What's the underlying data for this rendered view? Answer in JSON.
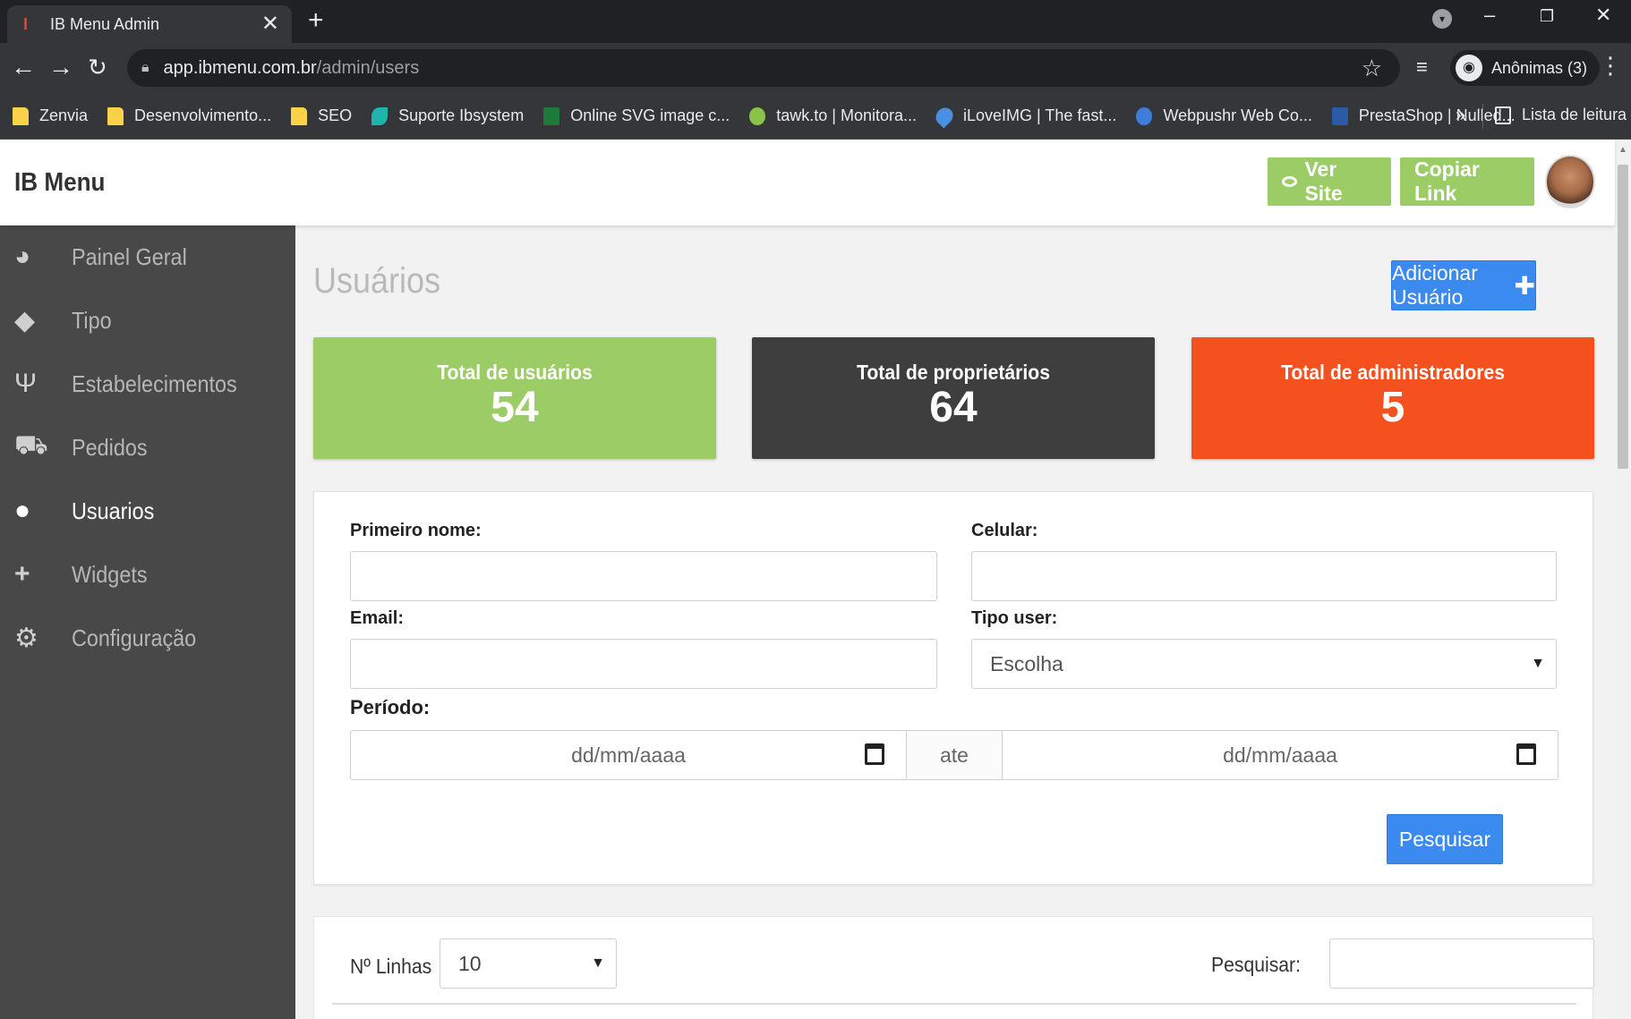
{
  "browser": {
    "tab_title": "IB Menu Admin",
    "tab_close": "✕",
    "new_tab": "+",
    "url_host": "app.ibmenu.com.br",
    "url_path": "/admin/users",
    "profile_label": "Anônimas (3)",
    "bookmarks": [
      {
        "label": "Zenvia",
        "icon": "folder-icon"
      },
      {
        "label": "Desenvolvimento...",
        "icon": "folder-icon"
      },
      {
        "label": "SEO",
        "icon": "folder-icon"
      },
      {
        "label": "Suporte Ibsystem",
        "icon": "wave-icon"
      },
      {
        "label": "Online SVG image c...",
        "icon": "excel-icon"
      },
      {
        "label": "tawk.to | Monitora...",
        "icon": "bird-icon"
      },
      {
        "label": "iLoveIMG | The fast...",
        "icon": "heart-icon"
      },
      {
        "label": "Webpushr Web Co...",
        "icon": "rocket-icon"
      },
      {
        "label": "PrestaShop | Nulled...",
        "icon": "n-icon"
      }
    ],
    "bookmarks_more": "»",
    "reading_list": "Lista de leitura"
  },
  "header": {
    "brand": "IB Menu",
    "view_site": "Ver Site",
    "copy_link": "Copiar Link"
  },
  "sidebar": {
    "items": [
      {
        "label": "Painel Geral",
        "icon": "palette-icon"
      },
      {
        "label": "Tipo",
        "icon": "tags-icon"
      },
      {
        "label": "Estabelecimentos",
        "icon": "utensils-icon"
      },
      {
        "label": "Pedidos",
        "icon": "cart-icon"
      },
      {
        "label": "Usuarios",
        "icon": "users-icon",
        "active": true
      },
      {
        "label": "Widgets",
        "icon": "plus-icon"
      },
      {
        "label": "Configuração",
        "icon": "gear-icon"
      }
    ]
  },
  "main": {
    "title": "Usuários",
    "add_user": "Adicionar Usuário",
    "stats": [
      {
        "label": "Total de usuários",
        "value": "54",
        "color": "#9ccc65"
      },
      {
        "label": "Total de proprietários",
        "value": "64",
        "color": "#3e3e3e"
      },
      {
        "label": "Total de administradores",
        "value": "5",
        "color": "#f4511e"
      }
    ],
    "filters": {
      "first_name_label": "Primeiro nome:",
      "first_name_value": "",
      "phone_label": "Celular:",
      "phone_value": "",
      "email_label": "Email:",
      "email_value": "",
      "user_type_label": "Tipo user:",
      "user_type_selected": "Escolha",
      "period_label": "Período:",
      "date_from_placeholder": "dd/mm/aaaa",
      "date_separator": "ate",
      "date_to_placeholder": "dd/mm/aaaa",
      "search_button": "Pesquisar"
    },
    "table": {
      "rows_label": "Nº Linhas",
      "rows_selected": "10",
      "search_label": "Pesquisar:",
      "search_value": ""
    }
  },
  "colors": {
    "accent_blue": "#3b8af0",
    "green": "#9ccc65",
    "sidebar_bg": "#484848"
  }
}
